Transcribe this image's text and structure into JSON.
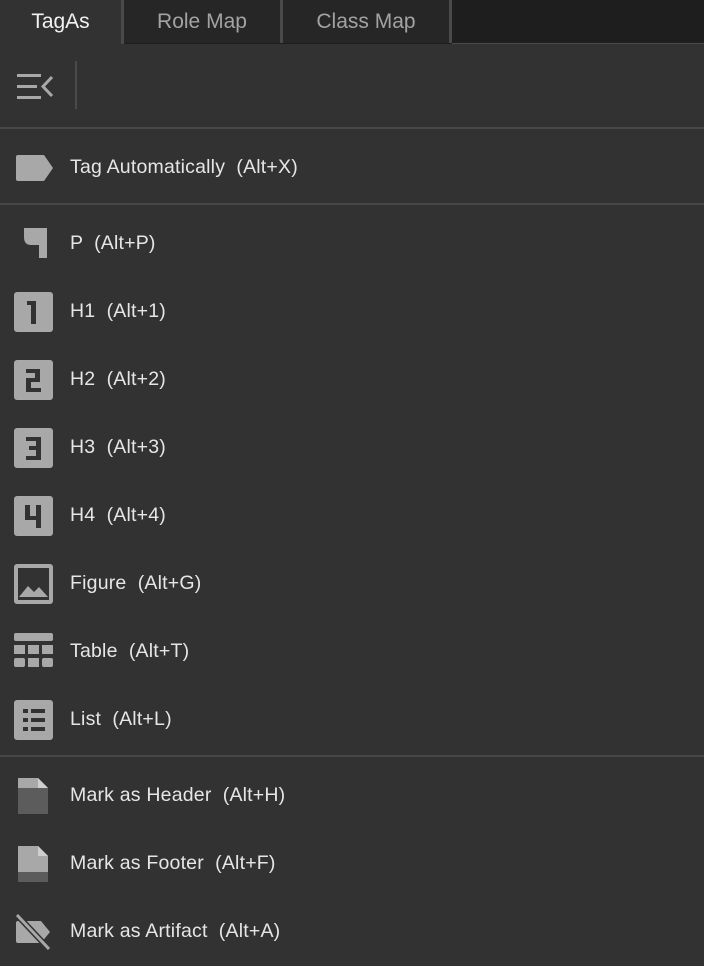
{
  "tabs": [
    {
      "label": "TagAs",
      "active": true
    },
    {
      "label": "Role Map",
      "active": false
    },
    {
      "label": "Class Map",
      "active": false
    }
  ],
  "toolbar": {
    "collapse_icon": "collapse-panel-icon"
  },
  "items": [
    {
      "label": "Tag Automatically  (Alt+X)",
      "icon": "tag-icon"
    },
    {
      "label": "P  (Alt+P)",
      "icon": "paragraph-icon"
    },
    {
      "label": "H1  (Alt+1)",
      "icon": "h1-icon"
    },
    {
      "label": "H2  (Alt+2)",
      "icon": "h2-icon"
    },
    {
      "label": "H3  (Alt+3)",
      "icon": "h3-icon"
    },
    {
      "label": "H4  (Alt+4)",
      "icon": "h4-icon"
    },
    {
      "label": "Figure  (Alt+G)",
      "icon": "image-icon"
    },
    {
      "label": "Table  (Alt+T)",
      "icon": "table-icon"
    },
    {
      "label": "List  (Alt+L)",
      "icon": "list-icon"
    },
    {
      "label": "Mark as Header  (Alt+H)",
      "icon": "header-page-icon"
    },
    {
      "label": "Mark as Footer  (Alt+F)",
      "icon": "footer-page-icon"
    },
    {
      "label": "Mark as Artifact  (Alt+A)",
      "icon": "artifact-hidden-icon"
    }
  ],
  "colors": {
    "background": "#323232",
    "tab_bar": "#1e1e1e",
    "icon": "#a8a8a8",
    "text": "#e6e6e6"
  }
}
